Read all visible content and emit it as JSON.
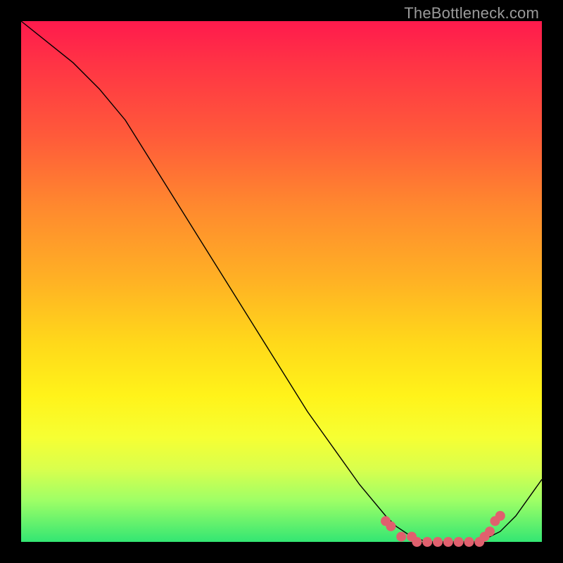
{
  "watermark": "TheBottleneck.com",
  "chart_data": {
    "type": "line",
    "title": "",
    "xlabel": "",
    "ylabel": "",
    "xlim": [
      0,
      100
    ],
    "ylim": [
      0,
      100
    ],
    "series": [
      {
        "name": "curve",
        "x": [
          0,
          5,
          10,
          15,
          20,
          25,
          30,
          35,
          40,
          45,
          50,
          55,
          60,
          65,
          70,
          72,
          75,
          78,
          80,
          82,
          85,
          88,
          90,
          92,
          95,
          100
        ],
        "values": [
          100,
          96,
          92,
          87,
          81,
          73,
          65,
          57,
          49,
          41,
          33,
          25,
          18,
          11,
          5,
          3,
          1,
          0,
          0,
          0,
          0,
          0,
          1,
          2,
          5,
          12
        ]
      },
      {
        "name": "dots",
        "x": [
          70,
          71,
          73,
          75,
          76,
          78,
          80,
          82,
          84,
          86,
          88,
          89,
          90,
          91,
          92
        ],
        "values": [
          4,
          3,
          1,
          1,
          0,
          0,
          0,
          0,
          0,
          0,
          0,
          1,
          2,
          4,
          5
        ]
      }
    ],
    "colors": {
      "curve": "#000000",
      "dots": "#e0606e"
    }
  }
}
